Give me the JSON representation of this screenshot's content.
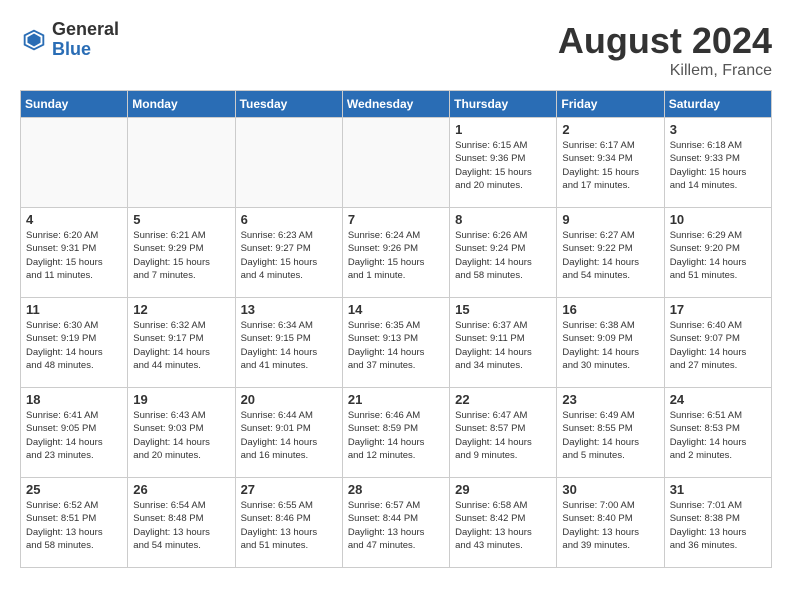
{
  "header": {
    "logo_general": "General",
    "logo_blue": "Blue",
    "month_year": "August 2024",
    "location": "Killem, France"
  },
  "days_of_week": [
    "Sunday",
    "Monday",
    "Tuesday",
    "Wednesday",
    "Thursday",
    "Friday",
    "Saturday"
  ],
  "weeks": [
    [
      {
        "day": "",
        "info": "",
        "empty": true
      },
      {
        "day": "",
        "info": "",
        "empty": true
      },
      {
        "day": "",
        "info": "",
        "empty": true
      },
      {
        "day": "",
        "info": "",
        "empty": true
      },
      {
        "day": "1",
        "info": "Sunrise: 6:15 AM\nSunset: 9:36 PM\nDaylight: 15 hours\nand 20 minutes."
      },
      {
        "day": "2",
        "info": "Sunrise: 6:17 AM\nSunset: 9:34 PM\nDaylight: 15 hours\nand 17 minutes."
      },
      {
        "day": "3",
        "info": "Sunrise: 6:18 AM\nSunset: 9:33 PM\nDaylight: 15 hours\nand 14 minutes."
      }
    ],
    [
      {
        "day": "4",
        "info": "Sunrise: 6:20 AM\nSunset: 9:31 PM\nDaylight: 15 hours\nand 11 minutes."
      },
      {
        "day": "5",
        "info": "Sunrise: 6:21 AM\nSunset: 9:29 PM\nDaylight: 15 hours\nand 7 minutes."
      },
      {
        "day": "6",
        "info": "Sunrise: 6:23 AM\nSunset: 9:27 PM\nDaylight: 15 hours\nand 4 minutes."
      },
      {
        "day": "7",
        "info": "Sunrise: 6:24 AM\nSunset: 9:26 PM\nDaylight: 15 hours\nand 1 minute."
      },
      {
        "day": "8",
        "info": "Sunrise: 6:26 AM\nSunset: 9:24 PM\nDaylight: 14 hours\nand 58 minutes."
      },
      {
        "day": "9",
        "info": "Sunrise: 6:27 AM\nSunset: 9:22 PM\nDaylight: 14 hours\nand 54 minutes."
      },
      {
        "day": "10",
        "info": "Sunrise: 6:29 AM\nSunset: 9:20 PM\nDaylight: 14 hours\nand 51 minutes."
      }
    ],
    [
      {
        "day": "11",
        "info": "Sunrise: 6:30 AM\nSunset: 9:19 PM\nDaylight: 14 hours\nand 48 minutes."
      },
      {
        "day": "12",
        "info": "Sunrise: 6:32 AM\nSunset: 9:17 PM\nDaylight: 14 hours\nand 44 minutes."
      },
      {
        "day": "13",
        "info": "Sunrise: 6:34 AM\nSunset: 9:15 PM\nDaylight: 14 hours\nand 41 minutes."
      },
      {
        "day": "14",
        "info": "Sunrise: 6:35 AM\nSunset: 9:13 PM\nDaylight: 14 hours\nand 37 minutes."
      },
      {
        "day": "15",
        "info": "Sunrise: 6:37 AM\nSunset: 9:11 PM\nDaylight: 14 hours\nand 34 minutes."
      },
      {
        "day": "16",
        "info": "Sunrise: 6:38 AM\nSunset: 9:09 PM\nDaylight: 14 hours\nand 30 minutes."
      },
      {
        "day": "17",
        "info": "Sunrise: 6:40 AM\nSunset: 9:07 PM\nDaylight: 14 hours\nand 27 minutes."
      }
    ],
    [
      {
        "day": "18",
        "info": "Sunrise: 6:41 AM\nSunset: 9:05 PM\nDaylight: 14 hours\nand 23 minutes."
      },
      {
        "day": "19",
        "info": "Sunrise: 6:43 AM\nSunset: 9:03 PM\nDaylight: 14 hours\nand 20 minutes."
      },
      {
        "day": "20",
        "info": "Sunrise: 6:44 AM\nSunset: 9:01 PM\nDaylight: 14 hours\nand 16 minutes."
      },
      {
        "day": "21",
        "info": "Sunrise: 6:46 AM\nSunset: 8:59 PM\nDaylight: 14 hours\nand 12 minutes."
      },
      {
        "day": "22",
        "info": "Sunrise: 6:47 AM\nSunset: 8:57 PM\nDaylight: 14 hours\nand 9 minutes."
      },
      {
        "day": "23",
        "info": "Sunrise: 6:49 AM\nSunset: 8:55 PM\nDaylight: 14 hours\nand 5 minutes."
      },
      {
        "day": "24",
        "info": "Sunrise: 6:51 AM\nSunset: 8:53 PM\nDaylight: 14 hours\nand 2 minutes."
      }
    ],
    [
      {
        "day": "25",
        "info": "Sunrise: 6:52 AM\nSunset: 8:51 PM\nDaylight: 13 hours\nand 58 minutes."
      },
      {
        "day": "26",
        "info": "Sunrise: 6:54 AM\nSunset: 8:48 PM\nDaylight: 13 hours\nand 54 minutes."
      },
      {
        "day": "27",
        "info": "Sunrise: 6:55 AM\nSunset: 8:46 PM\nDaylight: 13 hours\nand 51 minutes."
      },
      {
        "day": "28",
        "info": "Sunrise: 6:57 AM\nSunset: 8:44 PM\nDaylight: 13 hours\nand 47 minutes."
      },
      {
        "day": "29",
        "info": "Sunrise: 6:58 AM\nSunset: 8:42 PM\nDaylight: 13 hours\nand 43 minutes."
      },
      {
        "day": "30",
        "info": "Sunrise: 7:00 AM\nSunset: 8:40 PM\nDaylight: 13 hours\nand 39 minutes."
      },
      {
        "day": "31",
        "info": "Sunrise: 7:01 AM\nSunset: 8:38 PM\nDaylight: 13 hours\nand 36 minutes."
      }
    ]
  ]
}
